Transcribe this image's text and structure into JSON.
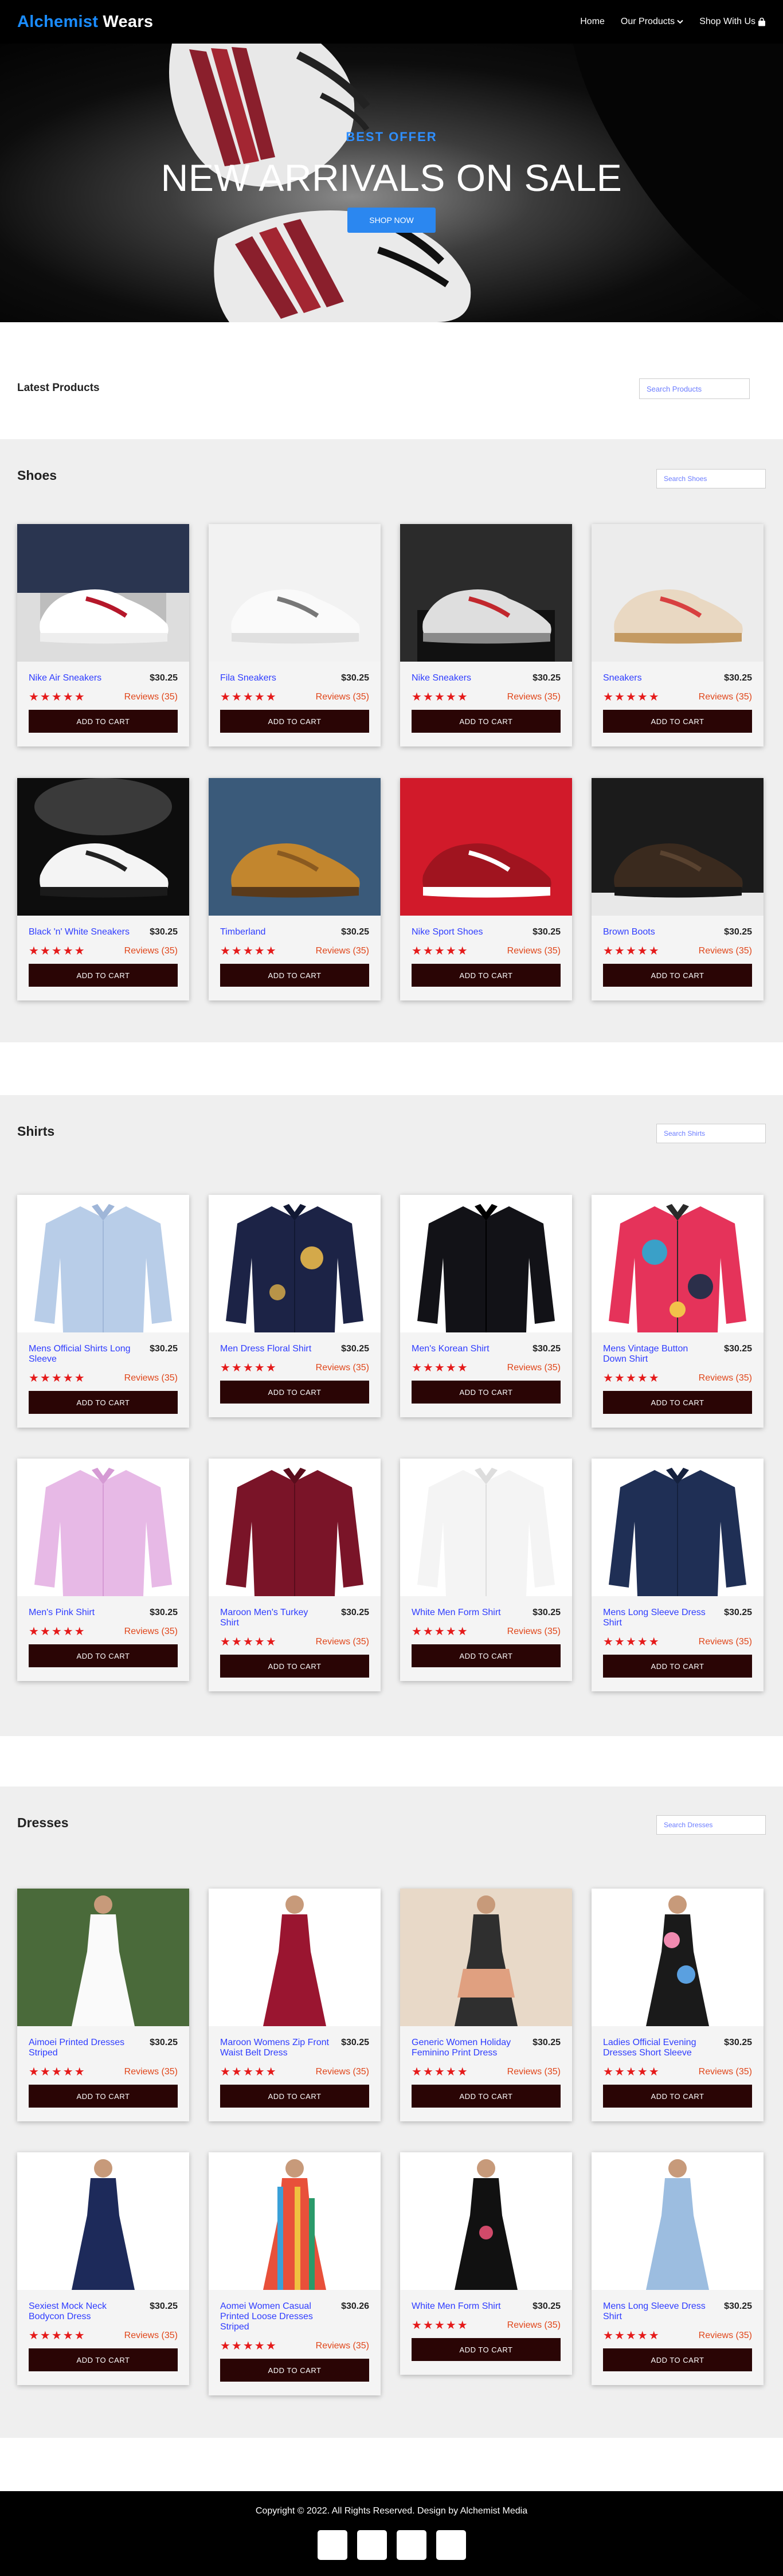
{
  "nav": {
    "brand_first": "Alchemist",
    "brand_second": "Wears",
    "links": [
      "Home",
      "Our Products",
      "Shop With Us"
    ]
  },
  "hero": {
    "kicker": "BEST OFFER",
    "title": "NEW ARRIVALS ON SALE",
    "cta": "SHOP NOW"
  },
  "latest": {
    "title": "Latest Products",
    "search_placeholder": "Search Products"
  },
  "product_defaults": {
    "stars": "★★★★★",
    "reviews": "Reviews (35)",
    "add_to_cart": "ADD TO CART"
  },
  "sections": [
    {
      "title": "Shoes",
      "search_placeholder": "Search Shoes",
      "products": [
        {
          "name": "Nike Air Sneakers",
          "price": "$30.25"
        },
        {
          "name": "Fila Sneakers",
          "price": "$30.25"
        },
        {
          "name": "Nike Sneakers",
          "price": "$30.25"
        },
        {
          "name": "Sneakers",
          "price": "$30.25"
        },
        {
          "name": "Black 'n' White Sneakers",
          "price": "$30.25"
        },
        {
          "name": "Timberland",
          "price": "$30.25"
        },
        {
          "name": "Nike Sport Shoes",
          "price": "$30.25"
        },
        {
          "name": "Brown Boots",
          "price": "$30.25"
        }
      ]
    },
    {
      "title": "Shirts",
      "search_placeholder": "Search Shirts",
      "products": [
        {
          "name": "Mens Official Shirts Long Sleeve",
          "price": "$30.25"
        },
        {
          "name": "Men Dress Floral Shirt",
          "price": "$30.25"
        },
        {
          "name": "Men's Korean Shirt",
          "price": "$30.25"
        },
        {
          "name": "Mens Vintage Button Down Shirt",
          "price": "$30.25"
        },
        {
          "name": "Men's Pink Shirt",
          "price": "$30.25"
        },
        {
          "name": "Maroon Men's Turkey Shirt",
          "price": "$30.25"
        },
        {
          "name": "White Men Form Shirt",
          "price": "$30.25"
        },
        {
          "name": "Mens Long Sleeve Dress Shirt",
          "price": "$30.25"
        }
      ]
    },
    {
      "title": "Dresses",
      "search_placeholder": "Search Dresses",
      "products": [
        {
          "name": "Aimoei Printed Dresses Striped",
          "price": "$30.25"
        },
        {
          "name": "Maroon Womens Zip Front Waist Belt Dress",
          "price": "$30.25"
        },
        {
          "name": "Generic Women Holiday Feminino Print Dress",
          "price": "$30.25"
        },
        {
          "name": "Ladies Official Evening Dresses Short Sleeve",
          "price": "$30.25"
        },
        {
          "name": "Sexiest Mock Neck Bodycon Dress",
          "price": "$30.25"
        },
        {
          "name": "Aomei Women Casual Printed Loose Dresses Striped",
          "price": "$30.26"
        },
        {
          "name": "White Men Form Shirt",
          "price": "$30.25"
        },
        {
          "name": "Mens Long Sleeve Dress Shirt",
          "price": "$30.25"
        }
      ]
    }
  ],
  "footer": {
    "copyright": "Copyright © 2022. All Rights Reserved. Design by Alchemist Media"
  }
}
